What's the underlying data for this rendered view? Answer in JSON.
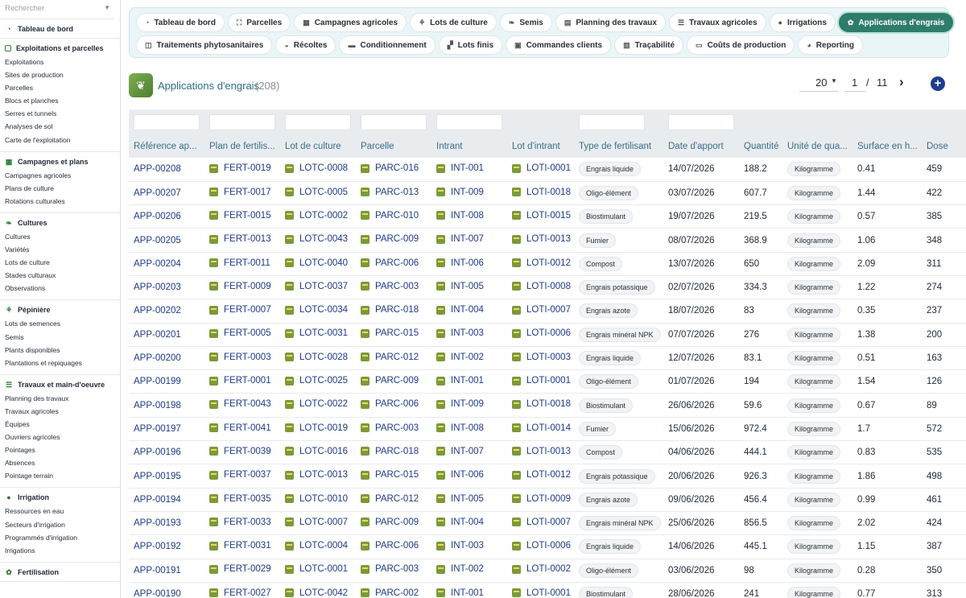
{
  "search": {
    "placeholder": "Rechercher"
  },
  "sidebar": {
    "sections": [
      {
        "title": "Tableau de bord",
        "icon": "dashboard-icon",
        "items": []
      },
      {
        "title": "Exploitations et parcelles",
        "icon": "farm-icon",
        "items": [
          "Exploitations",
          "Sites de production",
          "Parcelles",
          "Blocs et planches",
          "Serres et tunnels",
          "Analyses de sol",
          "Carte de l'exploitation"
        ]
      },
      {
        "title": "Campagnes et plans",
        "icon": "calendar-icon",
        "items": [
          "Campagnes agricoles",
          "Plans de culture",
          "Rotations culturales"
        ]
      },
      {
        "title": "Cultures",
        "icon": "leaf-icon",
        "items": [
          "Cultures",
          "Variétés",
          "Lots de culture",
          "Stades culturaux",
          "Observations"
        ]
      },
      {
        "title": "Pépinière",
        "icon": "sprout-icon",
        "items": [
          "Lots de semences",
          "Semis",
          "Plants disponibles",
          "Plantations et repiquages"
        ]
      },
      {
        "title": "Travaux et main-d'oeuvre",
        "icon": "list-icon",
        "items": [
          "Planning des travaux",
          "Travaux agricoles",
          "Équipes",
          "Ouvriers agricoles",
          "Pointages",
          "Absences",
          "Pointage terrain"
        ]
      },
      {
        "title": "Irrigation",
        "icon": "drop-icon",
        "items": [
          "Ressources en eau",
          "Secteurs d'irrigation",
          "Programmés d'irrigation",
          "Irrigations"
        ]
      },
      {
        "title": "Fertilisation",
        "icon": "fertilizer-icon",
        "items": []
      }
    ]
  },
  "tabs": [
    {
      "label": "Tableau de bord",
      "icon": "dashboard-icon"
    },
    {
      "label": "Parcelles",
      "icon": "frame-icon"
    },
    {
      "label": "Campagnes agricoles",
      "icon": "calendar-icon"
    },
    {
      "label": "Lots de culture",
      "icon": "sprout-icon"
    },
    {
      "label": "Semis",
      "icon": "leaf-icon"
    },
    {
      "label": "Planning des travaux",
      "icon": "planning-icon"
    },
    {
      "label": "Travaux agricoles",
      "icon": "list-icon"
    },
    {
      "label": "Irrigations",
      "icon": "drop-icon"
    },
    {
      "label": "Applications d'engrais",
      "icon": "fertilizer-icon",
      "active": true
    },
    {
      "label": "Traitements phytosanitaires",
      "icon": "spray-icon"
    },
    {
      "label": "Récoltes",
      "icon": "basket-icon"
    },
    {
      "label": "Conditionnement",
      "icon": "package-icon"
    },
    {
      "label": "Lots finis",
      "icon": "boxes-icon"
    },
    {
      "label": "Commandes clients",
      "icon": "clipboard-icon"
    },
    {
      "label": "Traçabilité",
      "icon": "barcode-icon"
    },
    {
      "label": "Coûts de production",
      "icon": "money-icon"
    },
    {
      "label": "Reporting",
      "icon": "chart-pie-icon"
    }
  ],
  "page": {
    "title": "Applications d'engrais",
    "count": "(208)",
    "per_page": "20",
    "current_page": "1",
    "separator": "/",
    "total_pages": "11"
  },
  "table": {
    "columns": [
      "Référence ap...",
      "Plan de fertilis...",
      "Lot de culture",
      "Parcelle",
      "Intrant",
      "Lot d'intrant",
      "Type de fertilisant",
      "Date d'apport",
      "Quantité",
      "Unité de qua...",
      "Surface en h...",
      "Dose"
    ],
    "rows": [
      [
        "APP-00208",
        "FERT-0019",
        "LOTC-0008",
        "PARC-016",
        "INT-001",
        "LOTI-0001",
        "Engrais liquide",
        "14/07/2026",
        "188.2",
        "Kilogramme",
        "0.41",
        "459"
      ],
      [
        "APP-00207",
        "FERT-0017",
        "LOTC-0005",
        "PARC-013",
        "INT-009",
        "LOTI-0018",
        "Oligo-élément",
        "03/07/2026",
        "607.7",
        "Kilogramme",
        "1.44",
        "422"
      ],
      [
        "APP-00206",
        "FERT-0015",
        "LOTC-0002",
        "PARC-010",
        "INT-008",
        "LOTI-0015",
        "Biostimulant",
        "19/07/2026",
        "219.5",
        "Kilogramme",
        "0.57",
        "385"
      ],
      [
        "APP-00205",
        "FERT-0013",
        "LOTC-0043",
        "PARC-009",
        "INT-007",
        "LOTI-0013",
        "Fumier",
        "08/07/2026",
        "368.9",
        "Kilogramme",
        "1.06",
        "348"
      ],
      [
        "APP-00204",
        "FERT-0011",
        "LOTC-0040",
        "PARC-006",
        "INT-006",
        "LOTI-0012",
        "Compost",
        "13/07/2026",
        "650",
        "Kilogramme",
        "2.09",
        "311"
      ],
      [
        "APP-00203",
        "FERT-0009",
        "LOTC-0037",
        "PARC-003",
        "INT-005",
        "LOTI-0008",
        "Engrais potassique",
        "02/07/2026",
        "334.3",
        "Kilogramme",
        "1.22",
        "274"
      ],
      [
        "APP-00202",
        "FERT-0007",
        "LOTC-0034",
        "PARC-018",
        "INT-004",
        "LOTI-0007",
        "Engrais azote",
        "18/07/2026",
        "83",
        "Kilogramme",
        "0.35",
        "237"
      ],
      [
        "APP-00201",
        "FERT-0005",
        "LOTC-0031",
        "PARC-015",
        "INT-003",
        "LOTI-0006",
        "Engrais minéral NPK",
        "07/07/2026",
        "276",
        "Kilogramme",
        "1.38",
        "200"
      ],
      [
        "APP-00200",
        "FERT-0003",
        "LOTC-0028",
        "PARC-012",
        "INT-002",
        "LOTI-0003",
        "Engrais liquide",
        "12/07/2026",
        "83.1",
        "Kilogramme",
        "0.51",
        "163"
      ],
      [
        "APP-00199",
        "FERT-0001",
        "LOTC-0025",
        "PARC-009",
        "INT-001",
        "LOTI-0001",
        "Oligo-élément",
        "01/07/2026",
        "194",
        "Kilogramme",
        "1.54",
        "126"
      ],
      [
        "APP-00198",
        "FERT-0043",
        "LOTC-0022",
        "PARC-006",
        "INT-009",
        "LOTI-0018",
        "Biostimulant",
        "26/06/2026",
        "59.6",
        "Kilogramme",
        "0.67",
        "89"
      ],
      [
        "APP-00197",
        "FERT-0041",
        "LOTC-0019",
        "PARC-003",
        "INT-008",
        "LOTI-0014",
        "Fumier",
        "15/06/2026",
        "972.4",
        "Kilogramme",
        "1.7",
        "572"
      ],
      [
        "APP-00196",
        "FERT-0039",
        "LOTC-0016",
        "PARC-018",
        "INT-007",
        "LOTI-0013",
        "Compost",
        "04/06/2026",
        "444.1",
        "Kilogramme",
        "0.83",
        "535"
      ],
      [
        "APP-00195",
        "FERT-0037",
        "LOTC-0013",
        "PARC-015",
        "INT-006",
        "LOTI-0012",
        "Engrais potassique",
        "20/06/2026",
        "926.3",
        "Kilogramme",
        "1.86",
        "498"
      ],
      [
        "APP-00194",
        "FERT-0035",
        "LOTC-0010",
        "PARC-012",
        "INT-005",
        "LOTI-0009",
        "Engrais azote",
        "09/06/2026",
        "456.4",
        "Kilogramme",
        "0.99",
        "461"
      ],
      [
        "APP-00193",
        "FERT-0033",
        "LOTC-0007",
        "PARC-009",
        "INT-004",
        "LOTI-0007",
        "Engrais minéral NPK",
        "25/06/2026",
        "856.5",
        "Kilogramme",
        "2.02",
        "424"
      ],
      [
        "APP-00192",
        "FERT-0031",
        "LOTC-0004",
        "PARC-006",
        "INT-003",
        "LOTI-0006",
        "Engrais liquide",
        "14/06/2026",
        "445.1",
        "Kilogramme",
        "1.15",
        "387"
      ],
      [
        "APP-00191",
        "FERT-0029",
        "LOTC-0001",
        "PARC-003",
        "INT-002",
        "LOTI-0002",
        "Oligo-élément",
        "03/06/2026",
        "98",
        "Kilogramme",
        "0.28",
        "350"
      ],
      [
        "APP-00190",
        "FERT-0027",
        "LOTC-0042",
        "PARC-002",
        "INT-001",
        "LOTI-0001",
        "Biostimulant",
        "28/06/2026",
        "241",
        "Kilogramme",
        "0.77",
        "313"
      ]
    ]
  },
  "colors": {
    "accent": "#2e7d6b",
    "link": "#1b3a8a",
    "header_text": "#3a6f8a",
    "add_button": "#1c3f8c"
  }
}
